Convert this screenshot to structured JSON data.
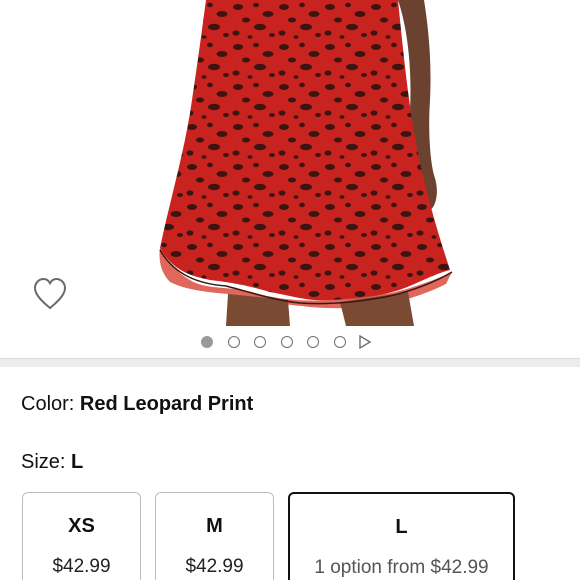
{
  "product": {
    "image_alt": "Red leopard print chiffon dress with handkerchief hem"
  },
  "carousel": {
    "dot_count": 6,
    "active_index": 0
  },
  "color": {
    "label": "Color:",
    "value": "Red Leopard Print"
  },
  "size": {
    "label": "Size:",
    "value": "L",
    "options": [
      {
        "name": "XS",
        "price": "$42.99",
        "selected": false
      },
      {
        "name": "M",
        "price": "$42.99",
        "selected": false
      },
      {
        "name": "L",
        "price": "1 option from $42.99",
        "selected": true
      }
    ]
  },
  "icons": {
    "wishlist": "heart-outline-icon",
    "carousel_next": "play-triangle-icon"
  },
  "colors": {
    "dress_red": "#c8231f",
    "spot_dark": "#3a1512",
    "dot_active": "#9a9a9a",
    "divider": "#ececec"
  }
}
